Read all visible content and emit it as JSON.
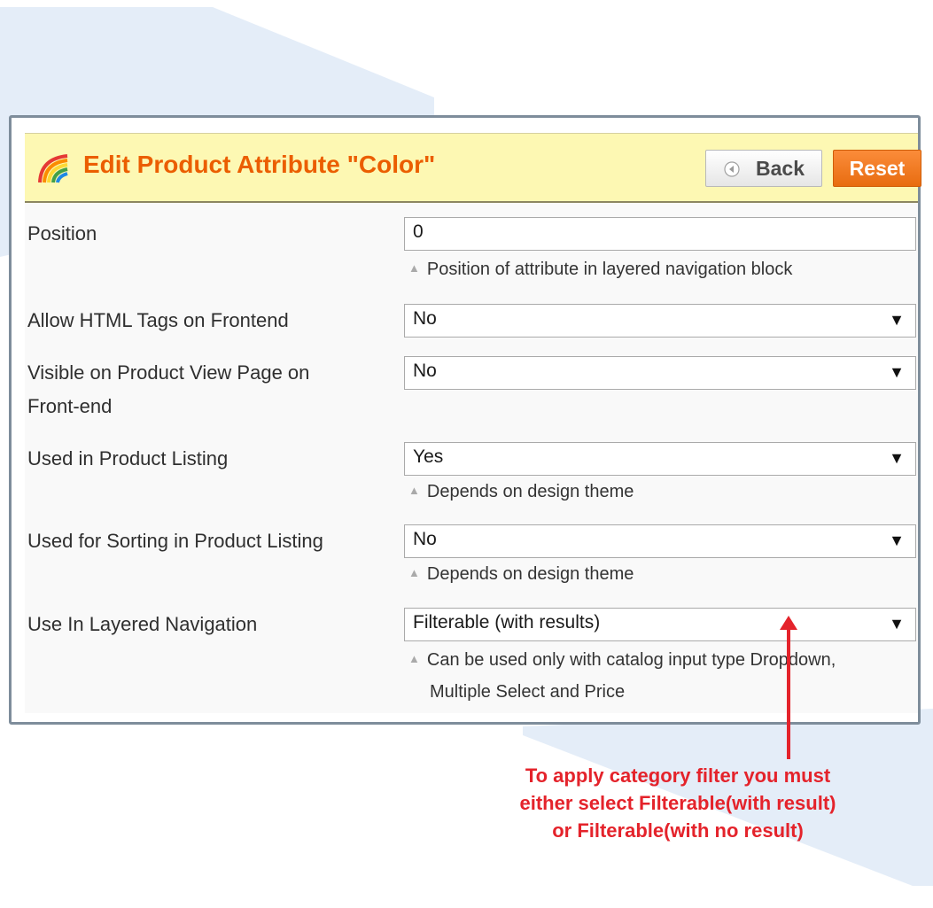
{
  "header": {
    "title": "Edit Product Attribute \"Color\"",
    "back_label": "Back",
    "reset_label": "Reset"
  },
  "form": {
    "position": {
      "label": "Position",
      "value": "0",
      "note": "Position of attribute in layered navigation block"
    },
    "allow_html": {
      "label": "Allow HTML Tags on Frontend",
      "value": "No"
    },
    "visible_on_view": {
      "label_line1": "Visible on Product View Page on",
      "label_line2": "Front-end",
      "value": "No"
    },
    "used_in_listing": {
      "label": "Used in Product Listing",
      "value": "Yes",
      "note": "Depends on design theme"
    },
    "used_for_sorting": {
      "label": "Used for Sorting in Product Listing",
      "value": "No",
      "note": "Depends on design theme"
    },
    "layered_nav": {
      "label": "Use In Layered Navigation",
      "value": "Filterable (with results)",
      "note_line1": "Can be used only with catalog input type Dropdown,",
      "note_line2": "Multiple Select and Price"
    }
  },
  "annotation": {
    "line1": "To apply category filter you must",
    "line2": "either select Filterable(with result)",
    "line3": "or Filterable(with no result)"
  },
  "colors": {
    "title": "#eb5e00",
    "header_bg": "#fdf8b3",
    "reset_button": "#f07a22",
    "annotation": "#e4232b",
    "background_shape": "#e4edf8"
  },
  "icons": {
    "title_icon": "rainbow-icon",
    "back_icon": "circle-left-arrow-icon",
    "select_caret": "triangle-down-icon",
    "note_marker": "triangle-up-icon"
  }
}
